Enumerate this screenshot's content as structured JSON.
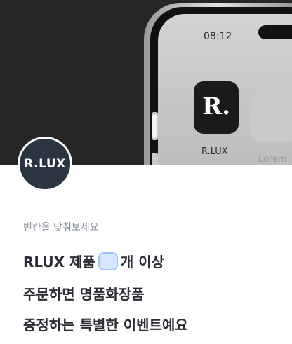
{
  "hero": {
    "phone_time": "08:12",
    "app_icon_letter": "R.",
    "app_label": "R.LUX",
    "placeholder_label": "Lorem"
  },
  "brand": {
    "logo_text": "R.LUX"
  },
  "quiz": {
    "instruction": "빈칸을 맞춰보세요",
    "line1_before": "RLUX 제품",
    "line1_after": "개 이상",
    "line2": "주문하면 명품화장품",
    "line3": "증정하는 특별한 이벤트예요"
  }
}
